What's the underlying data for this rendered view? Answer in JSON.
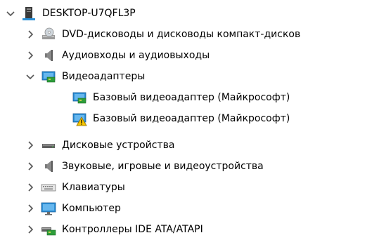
{
  "tree": {
    "root": {
      "label": "DESKTOP-U7QFL3P",
      "icon": "computer-tower-icon",
      "expanded": true
    },
    "items": [
      {
        "label": "DVD-дисководы и дисководы компакт-дисков",
        "icon": "dvd-drive-icon",
        "expanded": false
      },
      {
        "label": "Аудиовходы и аудиовыходы",
        "icon": "speaker-icon",
        "expanded": false
      },
      {
        "label": "Видеоадаптеры",
        "icon": "display-adapter-icon",
        "expanded": true,
        "children": [
          {
            "label": "Базовый видеоадаптер (Майкрософт)",
            "icon": "display-adapter-icon"
          },
          {
            "label": "Базовый видеоадаптер (Майкрософт)",
            "icon": "display-adapter-warning-icon"
          }
        ]
      },
      {
        "label": "Дисковые устройства",
        "icon": "disk-drive-icon",
        "expanded": false
      },
      {
        "label": "Звуковые, игровые и видеоустройства",
        "icon": "speaker-icon",
        "expanded": false
      },
      {
        "label": "Клавиатуры",
        "icon": "keyboard-icon",
        "expanded": false
      },
      {
        "label": "Компьютер",
        "icon": "monitor-icon",
        "expanded": false
      },
      {
        "label": "Контроллеры IDE ATA/ATAPI",
        "icon": "ide-controller-icon",
        "expanded": false
      }
    ]
  },
  "colors": {
    "chevron": "#555555",
    "warning": "#f5c400",
    "screen_blue": "#2b8fd6",
    "board_green": "#2e9e3a"
  }
}
